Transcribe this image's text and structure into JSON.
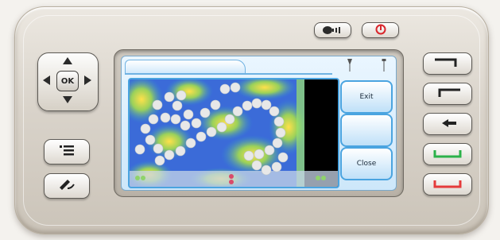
{
  "device": {
    "dpad_label": "OK"
  },
  "screen": {
    "title": "",
    "softkeys": [
      {
        "label": "Exit"
      },
      {
        "label": ""
      },
      {
        "label": "Close"
      }
    ]
  },
  "colors": {
    "softkey_border": "#4aa4e0",
    "power_icon": "#d9262c",
    "call_green": "#2bb24a",
    "end_red": "#e53b3b"
  }
}
